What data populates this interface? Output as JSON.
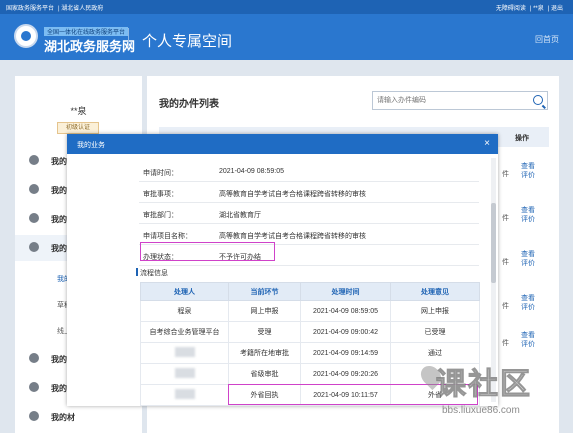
{
  "topbar": {
    "left_links": [
      "国家政务服务平台",
      "湖北省人民政府"
    ],
    "right_links": [
      "无障碍阅读",
      "**泉",
      "退出"
    ]
  },
  "header": {
    "logo_subtitle": "全国一体化在线政务服务平台",
    "logo_title": "湖北政务服务网",
    "page_title": "个人专属空间",
    "home_link": "回首页"
  },
  "sidebar": {
    "user_name": "**泉",
    "user_badge": "初级认证",
    "items": [
      {
        "label": "我的主"
      },
      {
        "label": "我的信"
      },
      {
        "label": "我的评"
      },
      {
        "label": "我的办"
      },
      {
        "label": "我的物"
      },
      {
        "label": "我的支"
      },
      {
        "label": "我的材"
      }
    ],
    "subitems": [
      "我的办",
      "草稿件",
      "线上线"
    ]
  },
  "main": {
    "title": "我的办件列表",
    "search_placeholder": "请输入办件编码",
    "op_header": "操作",
    "pj": "件",
    "op_view": "查看",
    "op_rate": "评价"
  },
  "modal": {
    "title": "我的业务",
    "close": "×",
    "info": [
      {
        "key": "申请时间：",
        "value": "2021-04-09 08:59:05"
      },
      {
        "key": "审批事项：",
        "value": "高等教育自学考试自考合格课程跨省转移的审核"
      },
      {
        "key": "审批部门：",
        "value": "湖北省教育厅"
      },
      {
        "key": "申请项目名称：",
        "value": "高等教育自学考试自考合格课程跨省转移的审核"
      },
      {
        "key": "办理状态：",
        "value": "不予许可办结"
      }
    ],
    "flow_title": "流程信息",
    "flow_headers": [
      "处理人",
      "当前环节",
      "处理时间",
      "处理意见"
    ],
    "flow_rows": [
      [
        "程泉",
        "网上申报",
        "2021-04-09 08:59:05",
        "网上申报"
      ],
      [
        "自考综合业务管理平台",
        "受理",
        "2021-04-09 09:00:42",
        "已受理"
      ],
      [
        "",
        "考籍所在地审批",
        "2021-04-09 09:14:59",
        "通过"
      ],
      [
        "",
        "省级审批",
        "2021-04-09 09:20:26",
        ""
      ],
      [
        "",
        "外省回执",
        "2021-04-09 10:11:57",
        "外省"
      ]
    ]
  },
  "watermark": {
    "text": "课社区",
    "url": "bbs.liuxue86.com"
  }
}
